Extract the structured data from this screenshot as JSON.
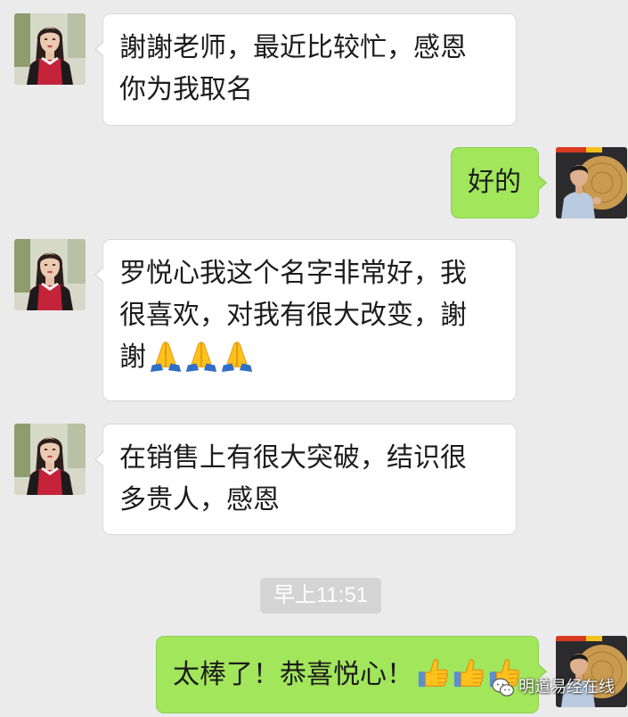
{
  "colors": {
    "background": "#ebebeb",
    "incoming_bubble": "#ffffff",
    "outgoing_bubble": "#a2e65b",
    "timestamp_background": "#d4d4d4",
    "timestamp_text": "#ffffff"
  },
  "avatars": {
    "contact": "woman-avatar-icon",
    "self": "man-avatar-icon"
  },
  "messages": [
    {
      "lines": [
        "謝謝老师，最近比较忙，感恩",
        "你为我取名"
      ],
      "emoji_icons": []
    },
    {
      "lines": [
        "好的"
      ],
      "emoji_icons": []
    },
    {
      "lines": [
        "罗悦心我这个名字非常好，我",
        "很喜欢，对我有很大改变，謝",
        "謝"
      ],
      "emoji_icons": [
        "praying-hands-icon",
        "praying-hands-icon",
        "praying-hands-icon"
      ]
    },
    {
      "lines": [
        "在销售上有很大突破，结识很",
        "多贵人，感恩"
      ],
      "emoji_icons": []
    },
    {
      "lines": [
        "太棒了！恭喜悦心！"
      ],
      "emoji_icons": [
        "thumbs-up-icon",
        "thumbs-up-icon",
        "thumbs-up-icon"
      ]
    }
  ],
  "timestamp": "早上11:51",
  "watermark": {
    "icon": "wechat-icon",
    "text": "明道易经在线"
  }
}
